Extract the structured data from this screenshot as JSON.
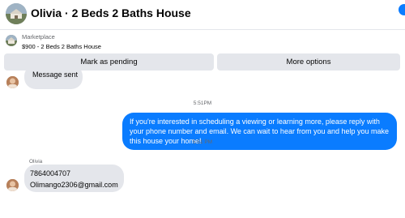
{
  "header": {
    "title": "Olivia · 2 Beds 2 Baths House"
  },
  "listing": {
    "source": "Marketplace",
    "name": "$900 - 2 Beds 2 Baths House"
  },
  "actions": {
    "pending_label": "Mark as pending",
    "more_label": "More options"
  },
  "messages": [
    {
      "text": "Message sent"
    },
    {
      "timestamp": "5:51PM"
    },
    {
      "text": "If you're interested in scheduling a viewing or learning more, please reply with your phone number and email. We can  wait to hear from you and help you make this house your home!"
    },
    {
      "timestamp": "5:51 PM"
    },
    {
      "sender": "Olivia"
    },
    {
      "lines": [
        "7864004707",
        "Olimango2306@gmail.com"
      ]
    }
  ],
  "colors": {
    "accent": "#0a7cff",
    "bubble_incoming": "#e4e6eb",
    "button_bg": "#e4e6eb"
  }
}
